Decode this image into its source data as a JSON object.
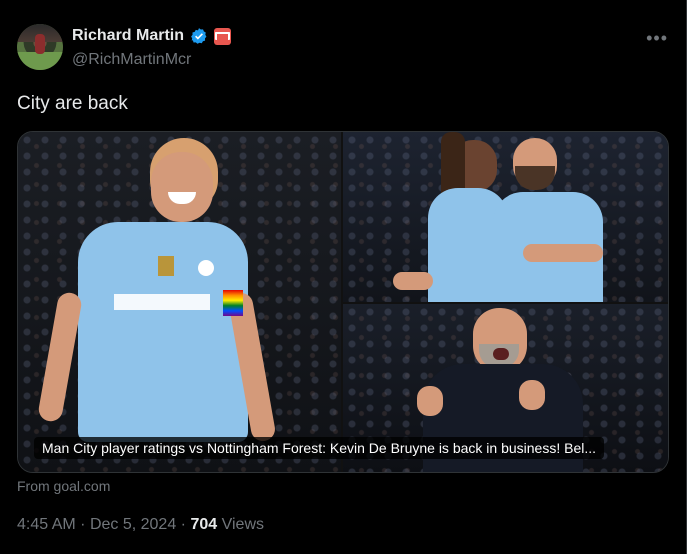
{
  "author": {
    "display_name": "Richard Martin",
    "handle": "@RichMartinMcr",
    "verified": true,
    "colors": {
      "verified": "#1d9bf0",
      "affiliate_badge": "#e8574f"
    }
  },
  "tweet": {
    "text": "City are back",
    "media_caption": "Man City player ratings vs Nottingham Forest: Kevin De Bruyne is back in business! Bel...",
    "source": "From goal.com",
    "time": "4:45 AM",
    "separator": "·",
    "date": "Dec 5, 2024",
    "views_count": "704",
    "views_label": "Views"
  },
  "menu": {
    "more_glyph": "•••"
  },
  "icons": {
    "verified": "verified-badge-icon",
    "affiliate": "affiliate-badge-icon",
    "more": "more-options-icon"
  }
}
